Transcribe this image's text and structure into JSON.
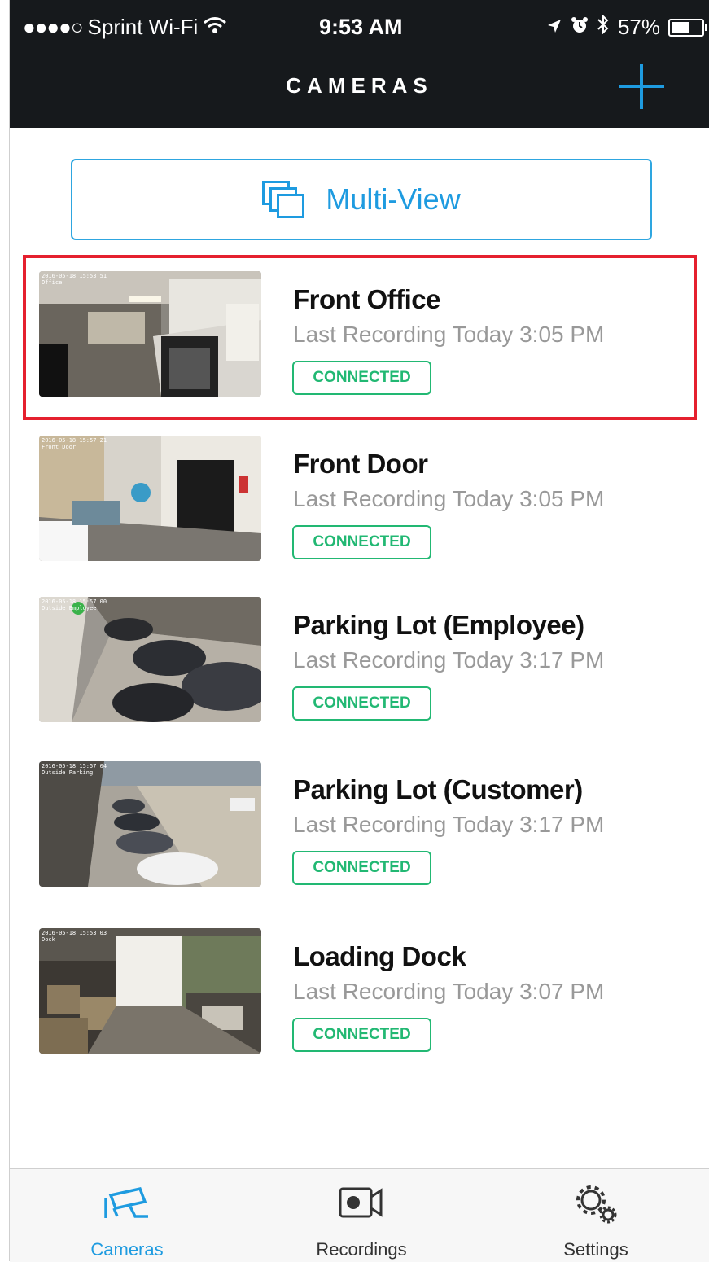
{
  "status_bar": {
    "signal": "●●●●○",
    "carrier": "Sprint Wi-Fi",
    "wifi_icon": "wifi-icon",
    "time": "9:53 AM",
    "battery": "57%",
    "battery_level": 0.57
  },
  "header": {
    "title": "CAMERAS",
    "add_icon": "plus-icon"
  },
  "multiview": {
    "label": "Multi-View",
    "icon": "multiview-icon"
  },
  "cameras": [
    {
      "name": "Front Office",
      "last": "Last Recording Today 3:05 PM",
      "status": "CONNECTED",
      "selected": true
    },
    {
      "name": "Front Door",
      "last": "Last Recording Today 3:05 PM",
      "status": "CONNECTED",
      "selected": false
    },
    {
      "name": "Parking Lot (Employee)",
      "last": "Last Recording Today 3:17 PM",
      "status": "CONNECTED",
      "selected": false
    },
    {
      "name": "Parking Lot (Customer)",
      "last": "Last Recording Today 3:17 PM",
      "status": "CONNECTED",
      "selected": false
    },
    {
      "name": "Loading Dock",
      "last": "Last Recording Today 3:07 PM",
      "status": "CONNECTED",
      "selected": false
    }
  ],
  "tabs": [
    {
      "label": "Cameras",
      "icon": "security-camera-icon",
      "active": true
    },
    {
      "label": "Recordings",
      "icon": "video-camera-icon",
      "active": false
    },
    {
      "label": "Settings",
      "icon": "gears-icon",
      "active": false
    }
  ],
  "colors": {
    "accent": "#1e9be0",
    "connected": "#22b873",
    "selection": "#e5202e",
    "header_bg": "#16191c"
  }
}
